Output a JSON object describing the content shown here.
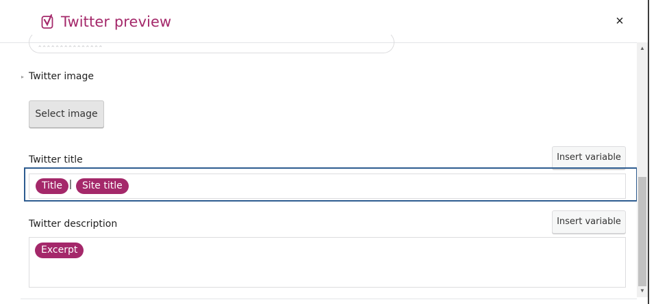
{
  "header": {
    "title": "Twitter preview",
    "close_label": "×",
    "logo_icon": "yoast-icon"
  },
  "colors": {
    "brand": "#a4286a",
    "focus": "#2c5b8f"
  },
  "image_section": {
    "label": "Twitter image",
    "select_button": "Select image"
  },
  "title_section": {
    "label": "Twitter title",
    "insert_variable": "Insert variable",
    "tokens": [
      "Title",
      "Site title"
    ],
    "separator": "|"
  },
  "description_section": {
    "label": "Twitter description",
    "insert_variable": "Insert variable",
    "tokens": [
      "Excerpt"
    ]
  }
}
